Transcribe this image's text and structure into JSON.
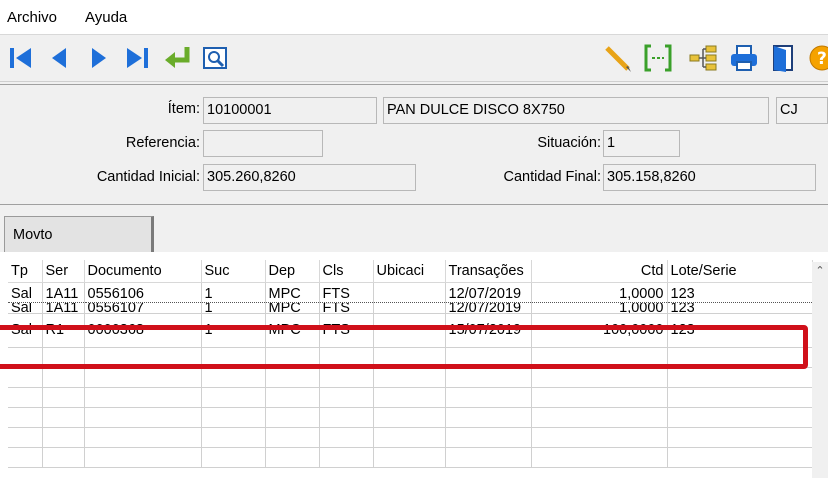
{
  "menu": {
    "file": "Archivo",
    "help": "Ayuda"
  },
  "toolbar": {
    "icons": [
      "first-record-icon",
      "previous-record-icon",
      "next-record-icon",
      "last-record-icon",
      "enter-icon",
      "preview-icon",
      "pencil-icon",
      "range-bracket-icon",
      "tree-icon",
      "print-icon",
      "exit-door-icon",
      "help-icon"
    ],
    "colors": {
      "nav": "#1e6fd9",
      "enter": "#6aac2a",
      "pencil": "#e8a317",
      "help": "#f5a200"
    }
  },
  "header": {
    "item_label": "Ítem:",
    "item_code": "10100001",
    "item_desc": "PAN DULCE DISCO 8X750",
    "item_unit": "CJ",
    "ref_label": "Referencia:",
    "ref_value": "",
    "situation_label": "Situación:",
    "situation_value": "1",
    "qty_initial_label": "Cantidad Inicial:",
    "qty_initial_value": "305.260,8260",
    "qty_final_label": "Cantidad Final:",
    "qty_final_value": "305.158,8260"
  },
  "tabs": {
    "movto": "Movto"
  },
  "grid": {
    "columns": [
      "Tp",
      "Ser",
      "Documento",
      "Suc",
      "Dep",
      "Cls",
      "Ubicaci",
      "Transações",
      "Ctd",
      "Lote/Serie"
    ],
    "rows": [
      {
        "tp": "Sal",
        "ser": "1A11",
        "doc": "0556106",
        "suc": "1",
        "dep": "MPC",
        "cls": "FTS",
        "ubic": "",
        "date": "12/07/2019",
        "ctd": "1,0000",
        "lote": "123"
      },
      {
        "tp": "Sal",
        "ser": "1A11",
        "doc": "0556107",
        "suc": "1",
        "dep": "MPC",
        "cls": "FTS",
        "ubic": "",
        "date": "12/07/2019",
        "ctd": "1,0000",
        "lote": "123"
      },
      {
        "tp": "Sal",
        "ser": "R1",
        "doc": "0000368",
        "suc": "1",
        "dep": "MPC",
        "cls": "FTS",
        "ubic": "",
        "date": "15/07/2019",
        "ctd": "100,0000",
        "lote": "123"
      }
    ],
    "highlight_color": "#d0101a"
  }
}
